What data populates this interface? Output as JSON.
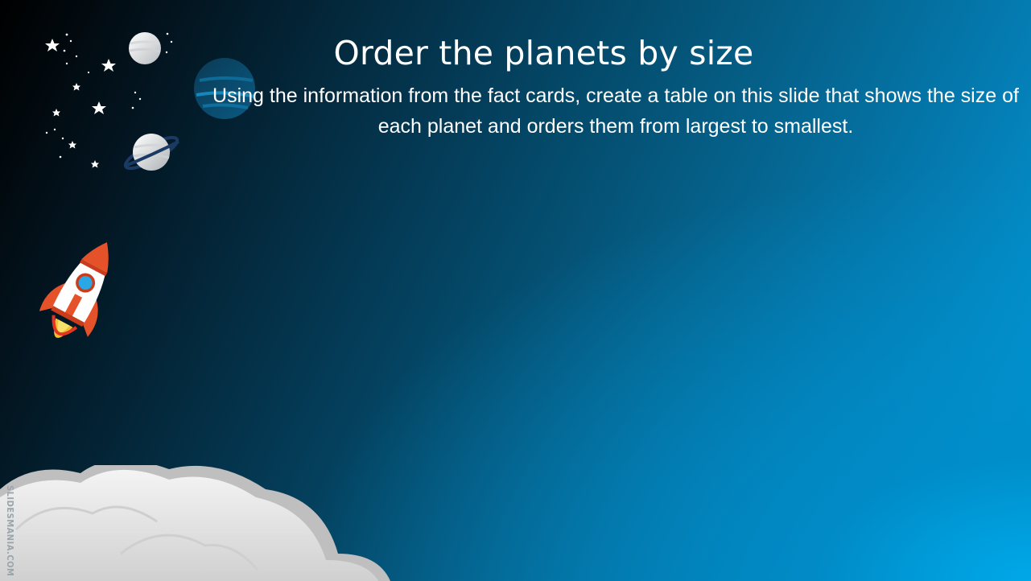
{
  "slide": {
    "title": "Order the planets by size",
    "instructions": "Using the information from the fact cards, create a table on this slide that shows the size of each planet and orders them from largest to smallest.",
    "watermark": "SLIDESMANIA.COM"
  },
  "decorations": {
    "icons": [
      "stars-icon",
      "planet-icon",
      "striped-planet-icon",
      "ringed-planet-icon",
      "rocket-icon",
      "cloud-icon"
    ],
    "colors": {
      "background_dark": "#000000",
      "background_light": "#00a8e8",
      "rocket_accent": "#e5522a"
    }
  }
}
